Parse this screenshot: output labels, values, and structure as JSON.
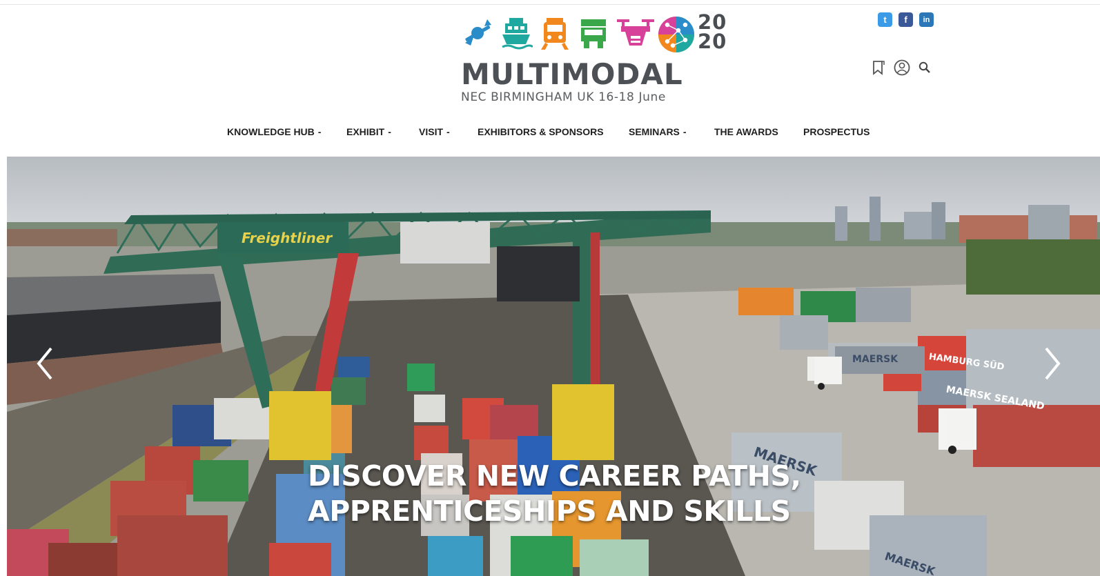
{
  "header": {
    "logo": {
      "year_top": "20",
      "year_bottom": "20",
      "brand": "MULTIMODAL",
      "tagline": "NEC BIRMINGHAM UK 16-18 June",
      "icon_names": [
        "ship-anchor-icon",
        "ferry-icon",
        "train-icon",
        "truck-icon",
        "drone-icon",
        "globe-network-icon"
      ],
      "icon_colors": [
        "#2a8cc8",
        "#1fa8a0",
        "#f2871e",
        "#3aa84a",
        "#d8419a",
        "#8dc63f"
      ]
    },
    "social": {
      "twitter": "t",
      "facebook": "f",
      "linkedin": "in",
      "colors": {
        "twitter": "#3c9be6",
        "facebook": "#3b5998",
        "linkedin": "#2b77b7"
      }
    },
    "utility_icons": [
      "bookmark-icon",
      "user-account-icon",
      "search-icon"
    ]
  },
  "nav": {
    "items": [
      {
        "label": "KNOWLEDGE HUB",
        "has_dropdown": true
      },
      {
        "label": "EXHIBIT",
        "has_dropdown": true
      },
      {
        "label": "VISIT",
        "has_dropdown": true
      },
      {
        "label": "EXHIBITORS & SPONSORS",
        "has_dropdown": false
      },
      {
        "label": "SEMINARS",
        "has_dropdown": true
      },
      {
        "label": "THE AWARDS",
        "has_dropdown": false
      },
      {
        "label": "PROSPECTUS",
        "has_dropdown": false
      }
    ],
    "caret": "-"
  },
  "hero": {
    "title_line1": "DISCOVER NEW CAREER PATHS,",
    "title_line2": "APPRENTICESHIPS AND SKILLS",
    "crane_brand": "Freightliner",
    "container_labels": [
      "MAERSK",
      "MAERSK",
      "MAERSK",
      "HAMBURG SÜD",
      "MAERSK SEALAND"
    ],
    "prev_icon": "chevron-left-icon",
    "next_icon": "chevron-right-icon"
  }
}
